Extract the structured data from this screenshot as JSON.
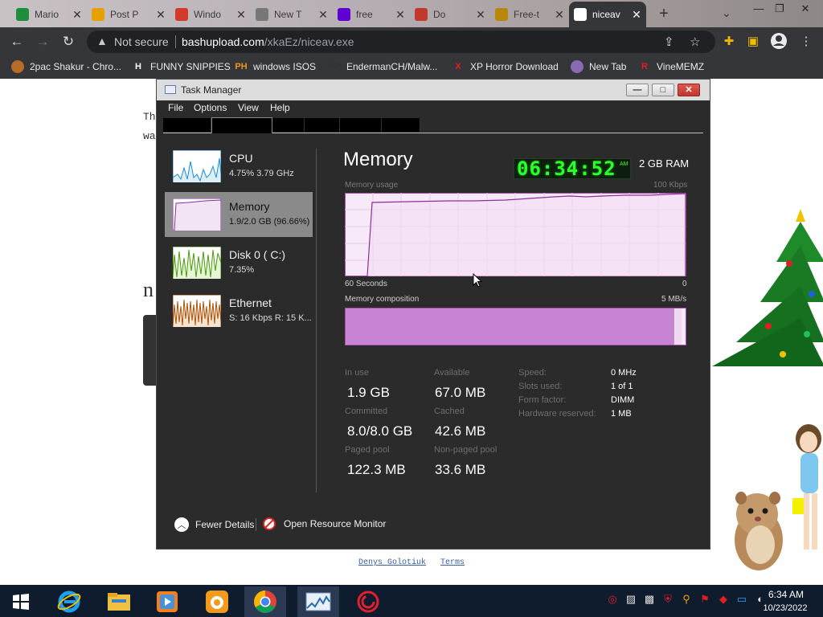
{
  "browser": {
    "tabs": [
      {
        "title": "Mario",
        "favicon": "sheets-icon",
        "color": "#1e8e3e"
      },
      {
        "title": "Post P",
        "favicon": "post-icon",
        "color": "#e8a000"
      },
      {
        "title": "Windo",
        "favicon": "windows-icon",
        "color": "#d23b2b"
      },
      {
        "title": "New T",
        "favicon": "search-icon",
        "color": "#777777"
      },
      {
        "title": "free",
        "favicon": "yahoo-icon",
        "color": "#6001d2"
      },
      {
        "title": "Do",
        "favicon": "download-icon",
        "color": "#c0392b"
      },
      {
        "title": "Free-t",
        "favicon": "coin-icon",
        "color": "#b8860b"
      },
      {
        "title": "niceav",
        "favicon": "cloud-upload-icon",
        "color": "#ffffff"
      }
    ],
    "new_tab": "+",
    "address": {
      "security_label": "Not secure",
      "host": "bashupload.com",
      "path": "/xkaEz/niceav.exe"
    },
    "bookmarks": [
      {
        "label": "2pac Shakur - Chro...",
        "icon": "puzzle-icon",
        "color": "#b96b2a"
      },
      {
        "label": "FUNNY SNIPPIES",
        "icon": "H",
        "color": "#ffffff"
      },
      {
        "label": "windows ISOS",
        "icon": "PH",
        "color": "#f7931a"
      },
      {
        "label": "EndermanCH/Malw...",
        "icon": "YP",
        "color": "#333333"
      },
      {
        "label": "XP Horror Download",
        "icon": "X",
        "color": "#e02020"
      },
      {
        "label": "New Tab",
        "icon": "world-icon",
        "color": "#8a6ab0"
      },
      {
        "label": "VineMEMZ",
        "icon": "R",
        "color": "#e02020"
      }
    ]
  },
  "webpage": {
    "line1": "Th",
    "line2": "wa",
    "heading": "n",
    "footer_links": [
      "Denys Golotiuk",
      "Terms"
    ]
  },
  "task_manager": {
    "title": "Task Manager",
    "menus": [
      "File",
      "Options",
      "View",
      "Help"
    ],
    "sidebar": [
      {
        "name": "CPU",
        "sub": "4.75%  3.79 GHz",
        "color": "#1c8dd0"
      },
      {
        "name": "Memory",
        "sub": "1.9/2.0 GB (96.66%)",
        "color": "#8b2f9e"
      },
      {
        "name": "Disk 0 ( C:)",
        "sub": "7.35%",
        "color": "#4a9a0a"
      },
      {
        "name": "Ethernet",
        "sub": "S: 16 Kbps R: 15 K...",
        "color": "#a9530a"
      }
    ],
    "detail": {
      "title": "Memory",
      "clock": "06:34:52",
      "clock_ampm": "AM",
      "total": "2 GB RAM",
      "usage_label": "Memory usage",
      "usage_max": "100 Kbps",
      "time_span": "60 Seconds",
      "time_zero": "0",
      "composition_label": "Memory composition",
      "composition_max": "5 MB/s",
      "in_use_fraction": 0.966,
      "stats": {
        "in_use": {
          "label": "In use",
          "value": "1.9 GB"
        },
        "available": {
          "label": "Available",
          "value": "67.0 MB"
        },
        "committed": {
          "label": "Committed",
          "value": "8.0/8.0 GB"
        },
        "cached": {
          "label": "Cached",
          "value": "42.6 MB"
        },
        "paged": {
          "label": "Paged pool",
          "value": "122.3 MB"
        },
        "nonpaged": {
          "label": "Non-paged pool",
          "value": "33.6 MB"
        }
      },
      "specs": [
        {
          "label": "Speed:",
          "value": "0 MHz"
        },
        {
          "label": "Slots used:",
          "value": "1 of 1"
        },
        {
          "label": "Form factor:",
          "value": "DIMM"
        },
        {
          "label": "Hardware reserved:",
          "value": "1 MB"
        }
      ],
      "accent": "#8b2f9e"
    },
    "footer": {
      "fewer_details": "Fewer Details",
      "open_resmon": "Open Resource Monitor"
    }
  },
  "taskbar": {
    "apps": [
      "windows-start-icon",
      "internet-explorer-icon",
      "file-explorer-icon",
      "media-player-icon",
      "uc-browser-icon",
      "chrome-icon",
      "task-manager-icon",
      "swirl-app-icon"
    ],
    "time": "6:34 AM",
    "date": "10/23/2022"
  }
}
